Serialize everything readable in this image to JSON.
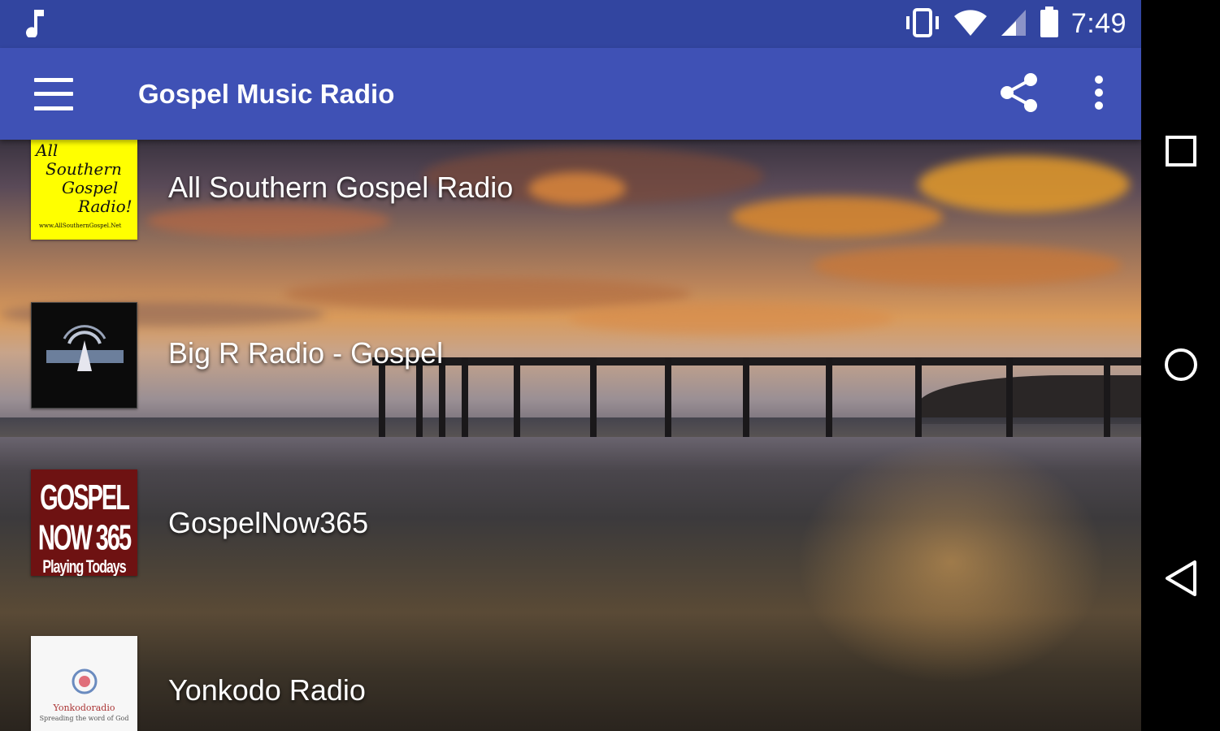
{
  "status_bar": {
    "time": "7:49",
    "icons": [
      "music-note-icon",
      "vibrate-icon",
      "wifi-icon",
      "signal-icon",
      "battery-icon"
    ]
  },
  "app_bar": {
    "title": "Gospel Music Radio",
    "background_color": "#3f51b5",
    "actions": [
      "share-icon",
      "more-vert-icon"
    ]
  },
  "stations": [
    {
      "name": "All Southern Gospel Radio",
      "logo": {
        "lines": [
          "All",
          "Southern",
          "Gospel",
          "Radio!"
        ],
        "small": "www.AllSouthernGospel.Net"
      }
    },
    {
      "name": "Big R Radio - Gospel",
      "logo": {
        "lines": []
      }
    },
    {
      "name": "GospelNow365",
      "logo": {
        "lines": [
          "GOSPEL NOW 365",
          "Playing Todays Best Gospel"
        ]
      }
    },
    {
      "name": "Yonkodo Radio",
      "logo": {
        "lines": [
          "Yonkodoradio",
          "Spreading the word of God"
        ]
      }
    }
  ],
  "nav_bar": {
    "buttons": [
      "recents-icon",
      "home-icon",
      "back-icon"
    ]
  }
}
